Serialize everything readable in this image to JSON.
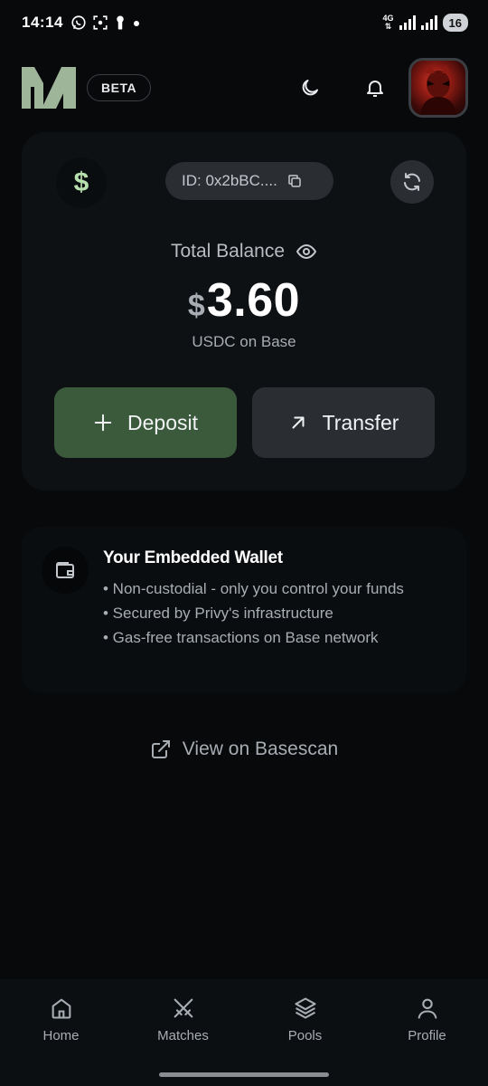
{
  "status_bar": {
    "time": "14:14",
    "network": "4G",
    "battery": "16",
    "icons": [
      "whatsapp-icon",
      "screenshot-icon",
      "keyhole-icon",
      "dot-icon"
    ]
  },
  "header": {
    "badge": "BETA",
    "icons": [
      "moon-icon",
      "bell-icon"
    ]
  },
  "balance_card": {
    "wallet_id": "ID: 0x2bBC....",
    "total_label": "Total Balance",
    "currency_symbol": "$",
    "dollar_icon_text": "$",
    "amount": "3.60",
    "network_label": "USDC on Base",
    "deposit_label": "Deposit",
    "transfer_label": "Transfer"
  },
  "info_card": {
    "title": "Your Embedded Wallet",
    "bullets": [
      "• Non-custodial - only you control your funds",
      "• Secured by Privy's infrastructure",
      "• Gas-free transactions on Base network"
    ]
  },
  "link": {
    "label": "View on Basescan"
  },
  "nav": {
    "items": [
      {
        "label": "Home",
        "icon": "home-icon"
      },
      {
        "label": "Matches",
        "icon": "swords-icon"
      },
      {
        "label": "Pools",
        "icon": "layers-icon"
      },
      {
        "label": "Profile",
        "icon": "user-icon"
      }
    ]
  },
  "colors": {
    "background": "#07090b",
    "card": "#0e1113",
    "accent_green": "#3b5a3b",
    "dollar_green": "#b7e0ae"
  }
}
